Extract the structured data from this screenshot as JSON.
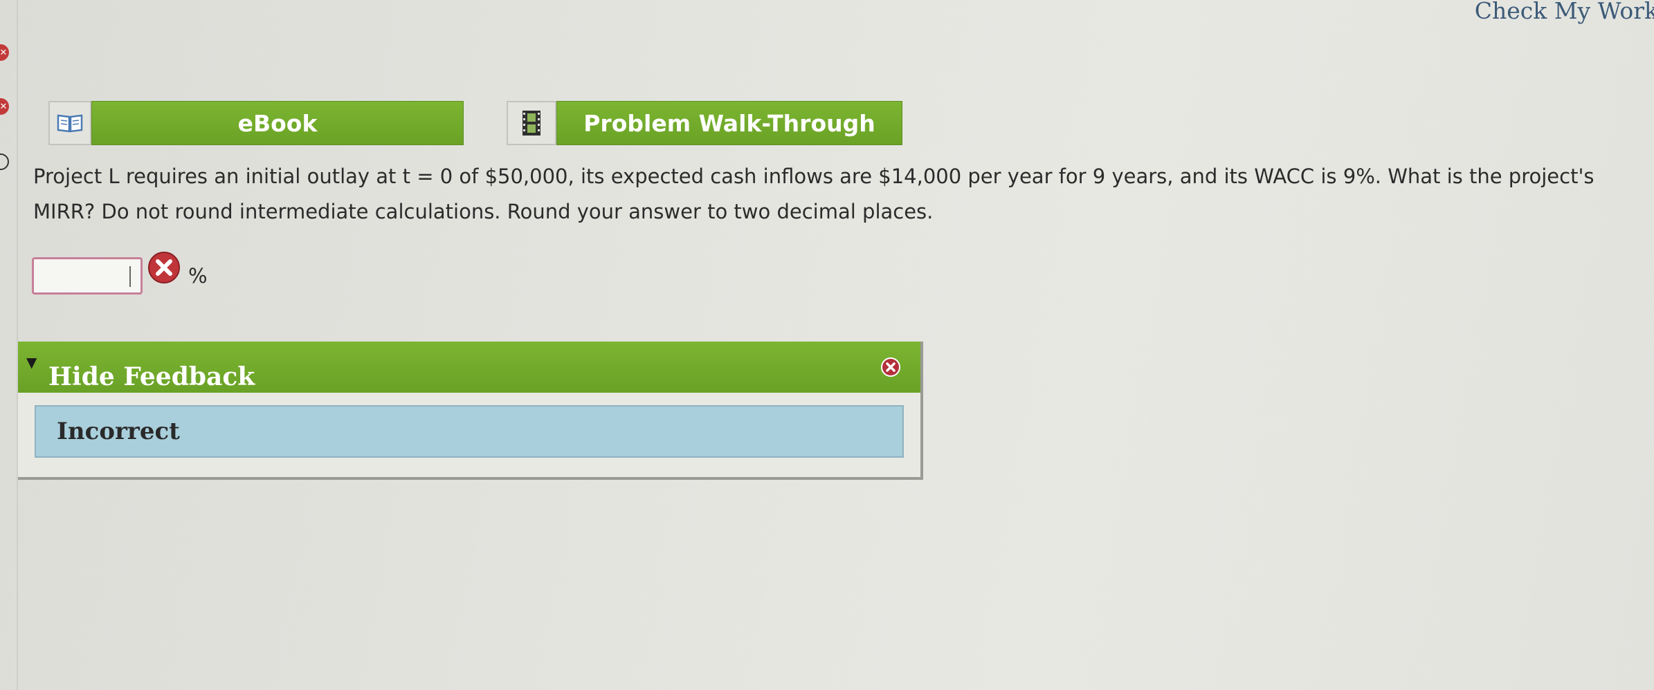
{
  "header": {
    "check_my_work_label": "Check My Work"
  },
  "toolbar": {
    "ebook_label": "eBook",
    "walkthrough_label": "Problem Walk-Through"
  },
  "question": {
    "text": "Project L requires an initial outlay at t = 0 of $50,000, its expected cash inflows are $14,000 per year for 9 years, and its WACC is 9%. What is the project's MIRR? Do not round intermediate calculations. Round your answer to two decimal places."
  },
  "answer": {
    "value": "",
    "unit": "%",
    "status_icon": "incorrect-icon"
  },
  "feedback": {
    "header_label": "Hide Feedback",
    "result_label": "Incorrect"
  },
  "colors": {
    "accent_green": "#72ac2b",
    "error_red": "#c0353a",
    "feedback_blue": "#a9cfdc",
    "link_blue": "#3c5a78"
  },
  "icons": {
    "ebook": "book-icon",
    "walkthrough": "film-icon",
    "answer_status": "incorrect-icon",
    "feedback_toggle": "triangle-down-icon",
    "feedback_close": "close-icon"
  }
}
